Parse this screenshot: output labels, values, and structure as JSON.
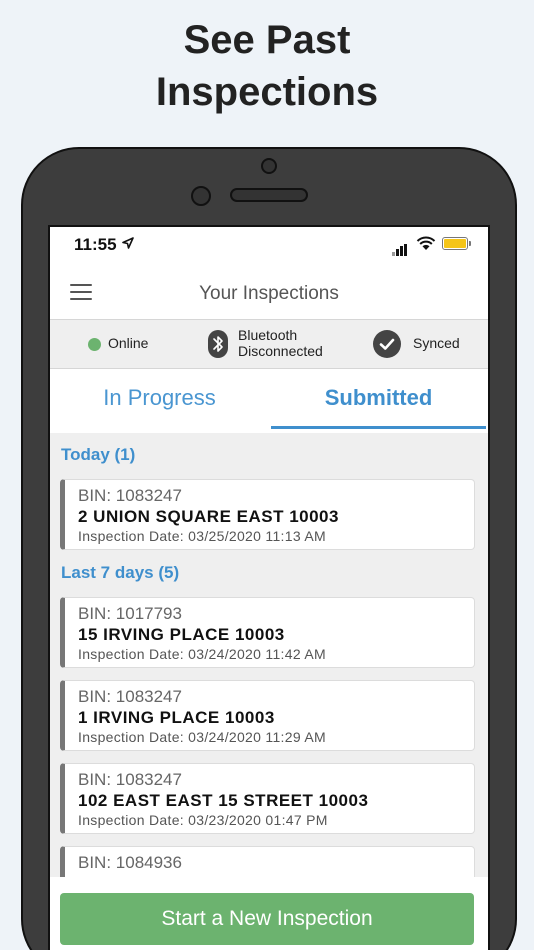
{
  "headline": {
    "line1": "See Past",
    "line2": "Inspections"
  },
  "status_bar": {
    "time": "11:55",
    "battery_color": "#f5c518"
  },
  "navbar": {
    "title": "Your Inspections",
    "menu_icon": "hamburger-icon"
  },
  "connection_strip": {
    "online_label": "Online",
    "online_color": "#6cb36f",
    "bluetooth_line1": "Bluetooth",
    "bluetooth_line2": "Disconnected",
    "sync_label": "Synced"
  },
  "tabs": [
    {
      "label": "In Progress",
      "active": false
    },
    {
      "label": "Submitted",
      "active": true
    }
  ],
  "sections": [
    {
      "header": "Today (1)",
      "items": [
        {
          "bin": "BIN:  1083247",
          "address": "2  UNION SQUARE  EAST  10003",
          "date": "Inspection Date:  03/25/2020 11:13 AM"
        }
      ]
    },
    {
      "header": "Last 7 days (5)",
      "items": [
        {
          "bin": "BIN:  1017793",
          "address": "15  IRVING  PLACE  10003",
          "date": "Inspection Date:  03/24/2020 11:42 AM"
        },
        {
          "bin": "BIN:  1083247",
          "address": "1  IRVING  PLACE  10003",
          "date": "Inspection Date:  03/24/2020 11:29 AM"
        },
        {
          "bin": "BIN:  1083247",
          "address": "102  EAST  EAST 15  STREET  10003",
          "date": "Inspection Date:  03/23/2020 01:47 PM"
        },
        {
          "bin": "BIN:  1084936",
          "address": "",
          "date": ""
        }
      ]
    }
  ],
  "cta": {
    "label": "Start a New Inspection",
    "color": "#6cb36f"
  },
  "accent_color": "#3f8fcd"
}
